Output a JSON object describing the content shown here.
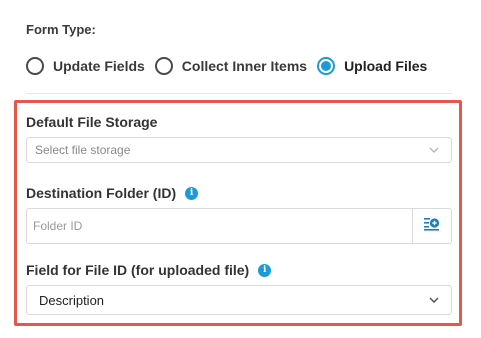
{
  "form_type": {
    "label": "Form Type:",
    "options": [
      {
        "label": "Update Fields",
        "selected": false
      },
      {
        "label": "Collect Inner Items",
        "selected": false
      },
      {
        "label": "Upload Files",
        "selected": true
      }
    ]
  },
  "default_file_storage": {
    "label": "Default File Storage",
    "placeholder": "Select file storage"
  },
  "destination_folder": {
    "label": "Destination Folder (ID)",
    "placeholder": "Folder ID",
    "value": ""
  },
  "field_for_file_id": {
    "label": "Field for File ID (for uploaded file)",
    "selected_value": "Description"
  },
  "colors": {
    "accent": "#1a9bd7",
    "highlight_border": "#e2584a"
  },
  "icons": {
    "info": "info-icon",
    "chevron": "chevron-down-icon",
    "add_list": "add-list-icon"
  }
}
